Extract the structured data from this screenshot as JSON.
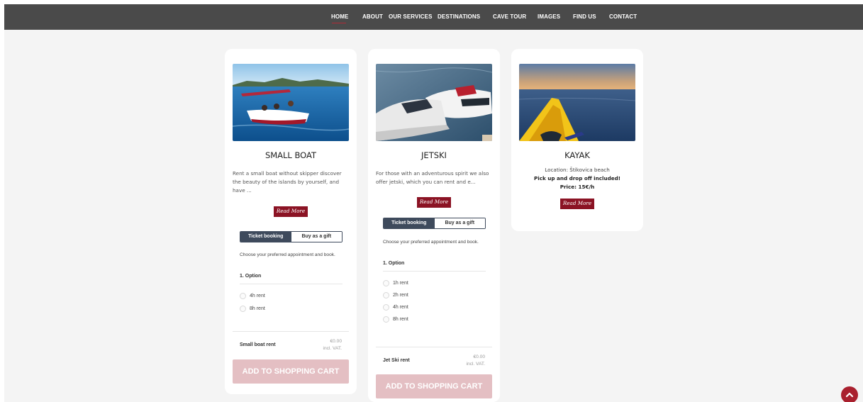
{
  "nav": {
    "items": [
      "HOME",
      "ABOUT",
      "OUR SERVICES",
      "DESTINATIONS",
      "CAVE TOUR",
      "IMAGES",
      "FIND US",
      "CONTACT"
    ],
    "active": "HOME"
  },
  "cards": {
    "small_boat": {
      "title": "SMALL BOAT",
      "description": "Rent a small boat without skipper discover the beauty of the islands by yourself, and have ...",
      "read_more": "Read More",
      "booking": {
        "tab_ticket": "Ticket booking",
        "tab_gift": "Buy as a gift",
        "intro": "Choose your preferred appointment and book.",
        "option_heading": "1. Option",
        "options": [
          "4h rent",
          "8h rent"
        ],
        "price_label": "Small boat rent",
        "price": "€0.00",
        "vat": "incl. VAT.",
        "cart_button": "ADD TO SHOPPING CART"
      }
    },
    "jetski": {
      "title": "JETSKI",
      "description": "For those with an adventurous spirit we also offer jetski, which you can rent and e...",
      "read_more": "Read More",
      "booking": {
        "tab_ticket": "Ticket booking",
        "tab_gift": "Buy as a gift",
        "intro": "Choose your preferred appointment and book.",
        "option_heading": "1. Option",
        "options": [
          "1h rent",
          "2h rent",
          "4h rent",
          "8h rent"
        ],
        "price_label": "Jet Ski rent",
        "price": "€0.00",
        "vat": "incl. VAT.",
        "cart_button": "ADD TO SHOPPING CART"
      }
    },
    "kayak": {
      "title": "KAYAK",
      "location": "Location: Štikovica beach",
      "pickup": "Pick up and drop off included!",
      "price": "Price: 15€/h",
      "read_more": "Read More"
    }
  },
  "colors": {
    "nav_bg": "#4a4a4a",
    "accent": "#8b1324",
    "toggle_active": "#3e4a5c",
    "cart_disabled": "#e4bfc3"
  },
  "icons": {
    "scroll_top": "chevron-up-icon"
  }
}
